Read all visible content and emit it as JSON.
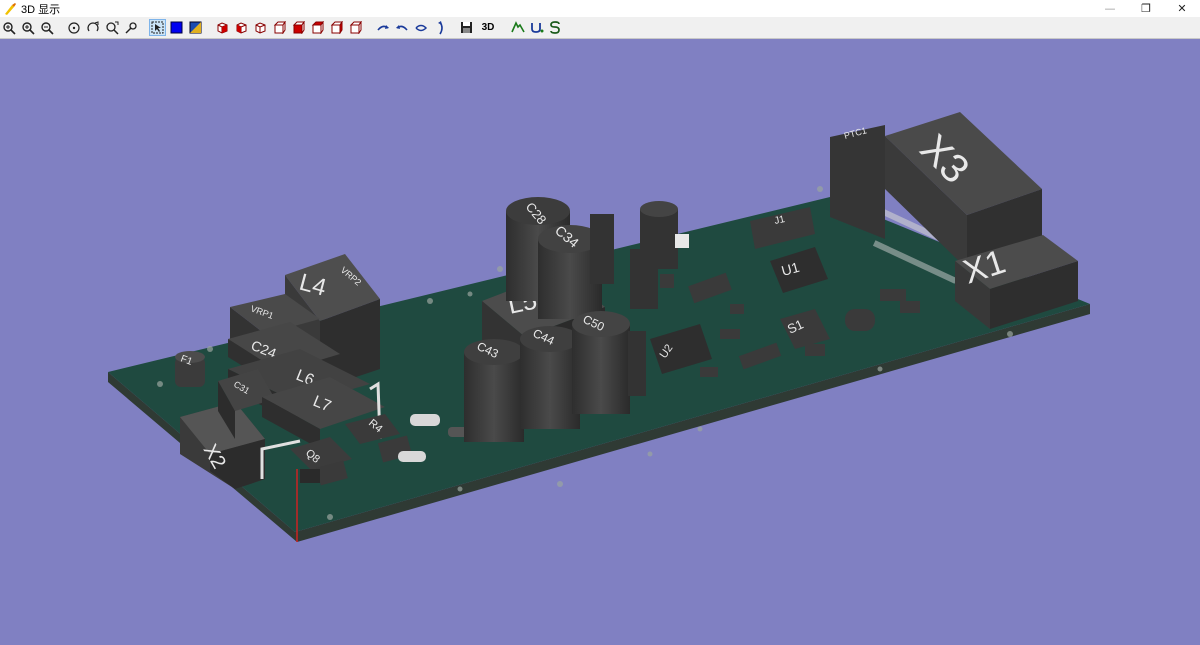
{
  "window": {
    "title": "3D 显示",
    "controls": {
      "minimize": "—",
      "restore": "❐",
      "close": "✕"
    }
  },
  "toolbar": {
    "buttons": [
      "zoom-fit-icon",
      "zoom-in-icon",
      "zoom-out-icon",
      "rotate-reset-icon",
      "rotate-free-icon",
      "zoom-area-icon",
      "measure-icon",
      "select-mode-icon",
      "background-blue-icon",
      "background-gradient-icon",
      "view-iso-icon",
      "view-front-icon",
      "view-back-icon",
      "view-left-icon",
      "view-right-icon",
      "view-top-icon",
      "view-bottom-icon",
      "rotate-x-icon",
      "rotate-y-icon",
      "rotate-z-icon",
      "flip-icon",
      "save-icon"
    ],
    "text_buttons": {
      "view3d": "3D",
      "export_p": "P",
      "export_u": "U",
      "export_s": "S"
    }
  },
  "scene": {
    "background": "#8080c2",
    "board_color": "#1f4a40",
    "component_color": "#3f3f3f",
    "labels": {
      "x3": "X3",
      "x1": "X1",
      "x2": "X2",
      "l4": "L4",
      "l5": "L5",
      "l6": "L6",
      "l7": "L7",
      "c24": "C24",
      "c28": "C28",
      "c34": "C34",
      "c43": "C43",
      "c44": "C44",
      "c50": "C50",
      "c31": "C31",
      "u1": "U1",
      "u2": "U2",
      "j1": "J1",
      "f1": "F1",
      "q8": "Q8",
      "r4": "R4",
      "ptc1": "PTC1",
      "vrp1": "VRP1",
      "vrp2": "VRP2",
      "s1": "S1"
    }
  }
}
